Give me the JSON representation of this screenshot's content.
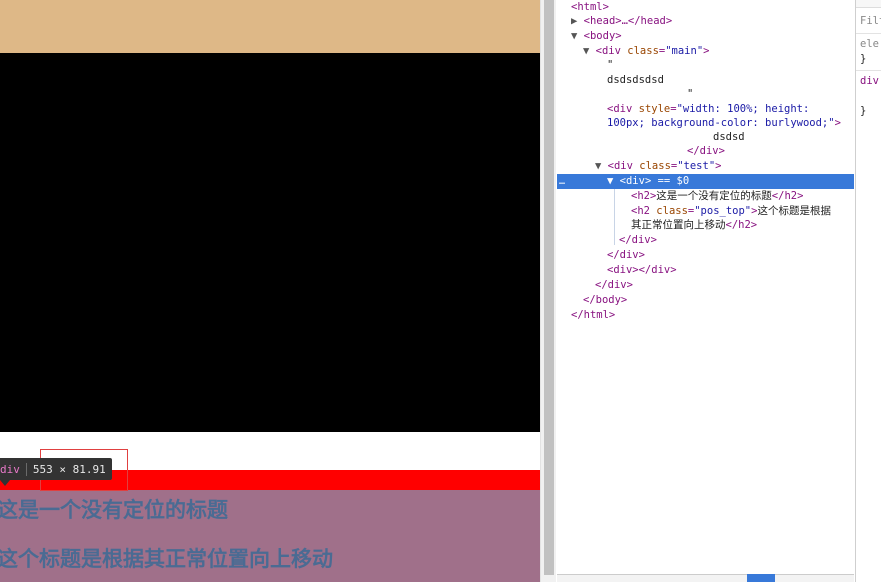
{
  "viewport": {
    "heading_unpositioned": "这是一个没有定位的标题",
    "heading_pos_top": "这个标题是根据其正常位置向上移动",
    "tooltip_tag": "div",
    "tooltip_size": "553 × 81.91"
  },
  "elements_tree": {
    "html_open": "<html>",
    "head": "<head>…</head>",
    "body_open": "<body>",
    "main_tag": "<div",
    "main_attr": "class",
    "main_val": "\"main\"",
    "quote1": "\"",
    "text_node": "dsdsdsdsd",
    "quote2": "\"",
    "styled_div_tag": "<div",
    "styled_div_attr": "style",
    "styled_div_val_1": "\"width: 100%; height:",
    "styled_div_val_2": "100px; background-color: burlywood;\"",
    "styled_div_close_bracket": ">",
    "styled_div_text": "dsdsd",
    "styled_div_close": "</div>",
    "test_tag": "<div",
    "test_attr": "class",
    "test_val": "\"test\"",
    "selected_dots": "…",
    "selected_div": "<div>",
    "selected_eq": "== $0",
    "h2_open": "<h2>",
    "h2_text": "这是一个没有定位的标题",
    "h2_close": "</h2>",
    "h2b_tag": "<h2",
    "h2b_attr": "class",
    "h2b_val": "\"pos_top\"",
    "h2b_text_1": "这个标题是根据",
    "h2b_text_2": "其正常位置向上移动",
    "h2b_close": "</h2>",
    "inner_div_close": "</div>",
    "test_div_close": "</div>",
    "empty_div": "<div></div>",
    "main_div_close": "</div>",
    "body_close": "</body>",
    "html_close": "</html>"
  },
  "styles_pane": {
    "filter": "Filte",
    "element_label": "ele",
    "brace1": "}",
    "div_label": "div",
    "brace2": "}"
  },
  "colors": {
    "burlywood": "#deb887",
    "black": "#000000",
    "red": "#ff0000",
    "highlight": "#a0708a",
    "heading": "#4a6b93",
    "selection": "#3879d9"
  }
}
